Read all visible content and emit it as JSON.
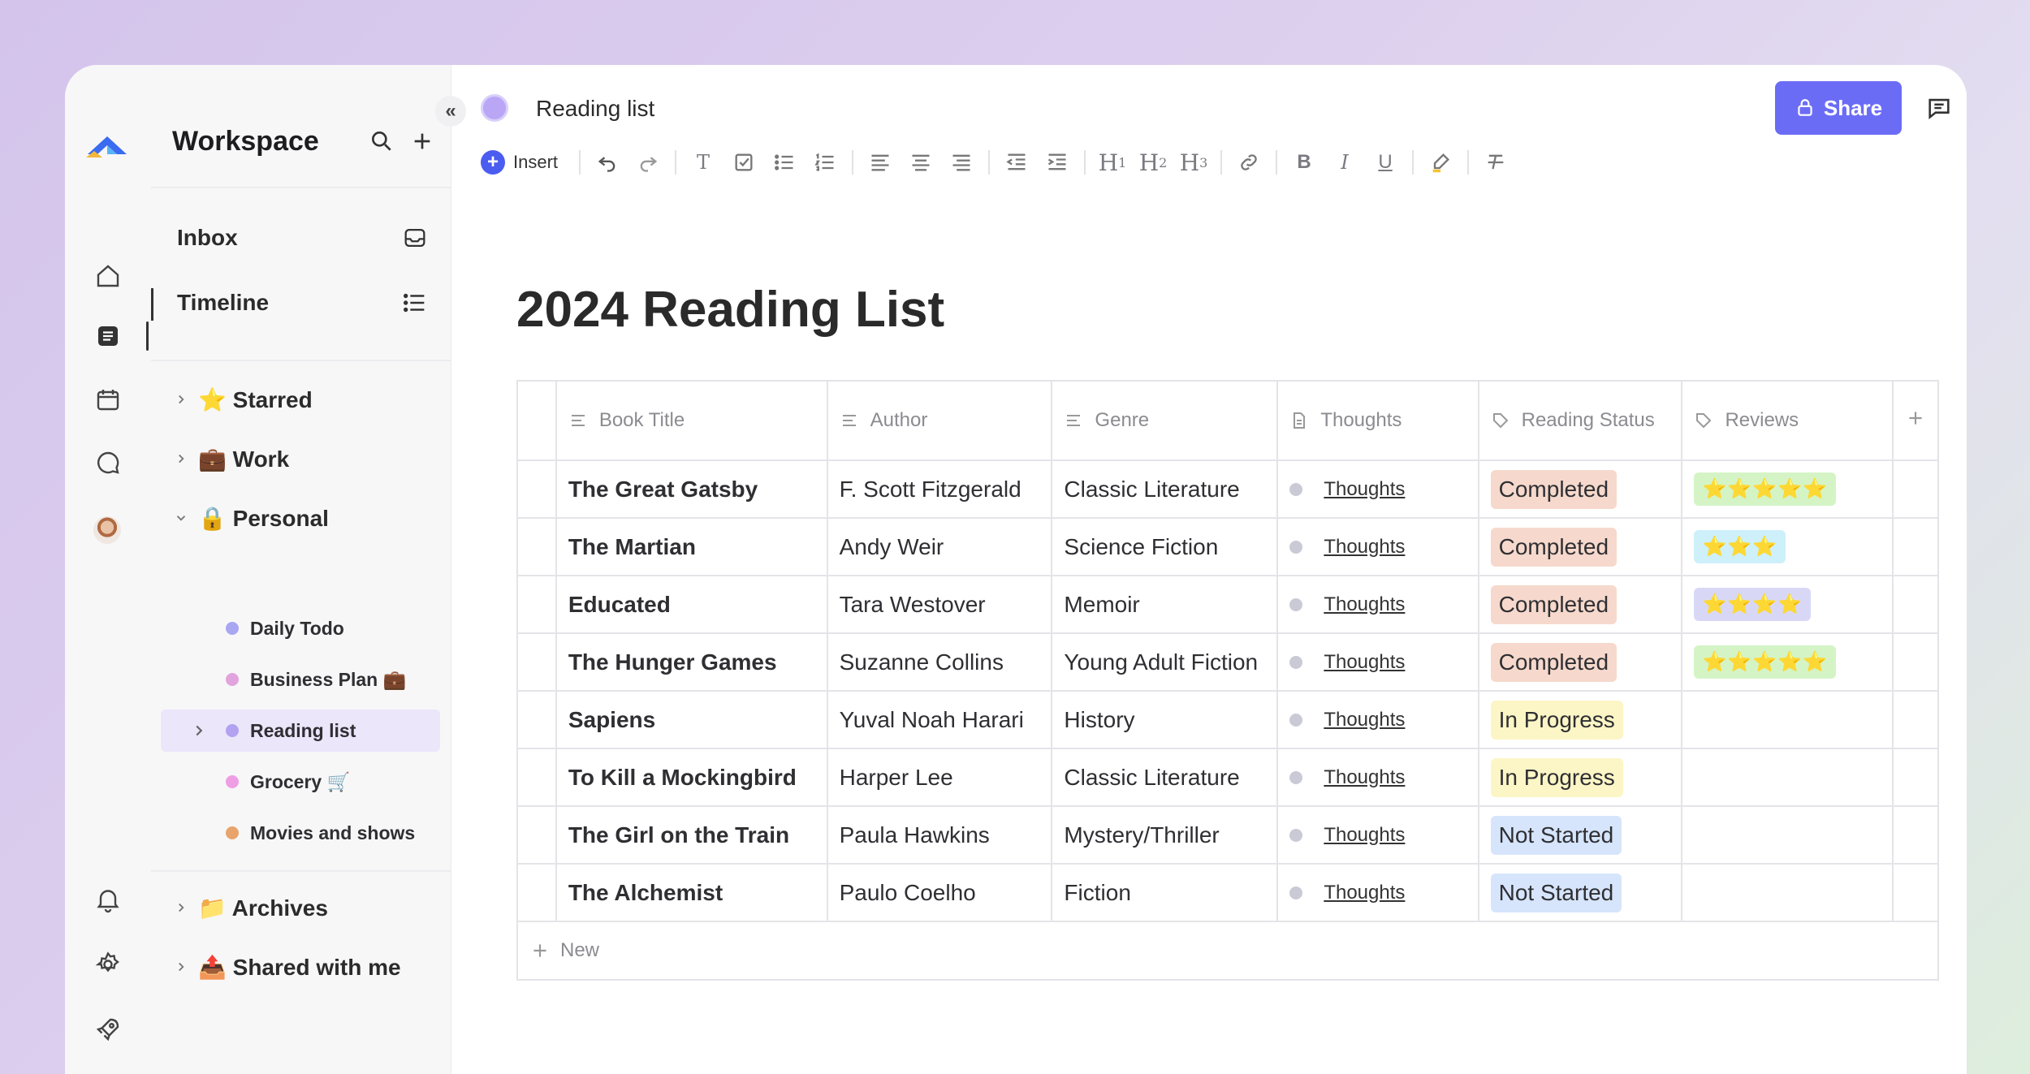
{
  "workspace": {
    "title": "Workspace"
  },
  "sidebar": {
    "inbox": "Inbox",
    "timeline": "Timeline",
    "groups": {
      "starred": "⭐ Starred",
      "work": "💼 Work",
      "personal": "🔒 Personal",
      "archives": "📁 Archives",
      "shared": "📤 Shared with me"
    },
    "pages": [
      {
        "label": "Daily Todo",
        "color": "#a9a7f2"
      },
      {
        "label": "Business Plan 💼",
        "color": "#e2a4dd"
      },
      {
        "label": "Reading list",
        "color": "#b3a2f0"
      },
      {
        "label": "Grocery 🛒",
        "color": "#ef9ee3"
      },
      {
        "label": "Movies and shows",
        "color": "#e9a46b"
      }
    ]
  },
  "header": {
    "page_name": "Reading list",
    "share_label": "Share"
  },
  "toolbar": {
    "insert_label": "Insert"
  },
  "doc": {
    "title": "2024 Reading List"
  },
  "table": {
    "columns": [
      "Book Title",
      "Author",
      "Genre",
      "Thoughts",
      "Reading Status",
      "Reviews"
    ],
    "rows": [
      {
        "title": "The Great Gatsby",
        "author": "F. Scott Fitzgerald",
        "genre": "Classic Literature",
        "thoughts": "Thoughts",
        "status": "Completed",
        "status_color": "#f6d9cc",
        "review": "⭐⭐⭐⭐⭐",
        "review_color": "#d4f4c6"
      },
      {
        "title": "The Martian",
        "author": "Andy Weir",
        "genre": "Science Fiction",
        "thoughts": "Thoughts",
        "status": "Completed",
        "status_color": "#f6d9cc",
        "review": "⭐⭐⭐",
        "review_color": "#cdf0fb"
      },
      {
        "title": "Educated",
        "author": "Tara Westover",
        "genre": "Memoir",
        "thoughts": "Thoughts",
        "status": "Completed",
        "status_color": "#f6d9cc",
        "review": "⭐⭐⭐⭐",
        "review_color": "#d8d8f6"
      },
      {
        "title": "The Hunger Games",
        "author": "Suzanne Collins",
        "genre": "Young Adult Fiction",
        "thoughts": "Thoughts",
        "status": "Completed",
        "status_color": "#f6d9cc",
        "review": "⭐⭐⭐⭐⭐",
        "review_color": "#d4f4c6"
      },
      {
        "title": "Sapiens",
        "author": "Yuval Noah Harari",
        "genre": "History",
        "thoughts": "Thoughts",
        "status": "In Progress",
        "status_color": "#fcf6c6",
        "review": "",
        "review_color": ""
      },
      {
        "title": "To Kill a Mockingbird",
        "author": "Harper Lee",
        "genre": "Classic Literature",
        "thoughts": "Thoughts",
        "status": "In Progress",
        "status_color": "#fcf6c6",
        "review": "",
        "review_color": ""
      },
      {
        "title": "The Girl on the Train",
        "author": "Paula Hawkins",
        "genre": "Mystery/Thriller",
        "thoughts": "Thoughts",
        "status": "Not Started",
        "status_color": "#d6e5fb",
        "review": "",
        "review_color": ""
      },
      {
        "title": "The Alchemist",
        "author": "Paulo Coelho",
        "genre": "Fiction",
        "thoughts": "Thoughts",
        "status": "Not Started",
        "status_color": "#d6e5fb",
        "review": "",
        "review_color": ""
      }
    ],
    "new_label": "New"
  },
  "colors": {
    "accent": "#6b6cf5",
    "insert": "#4b5cf0"
  }
}
